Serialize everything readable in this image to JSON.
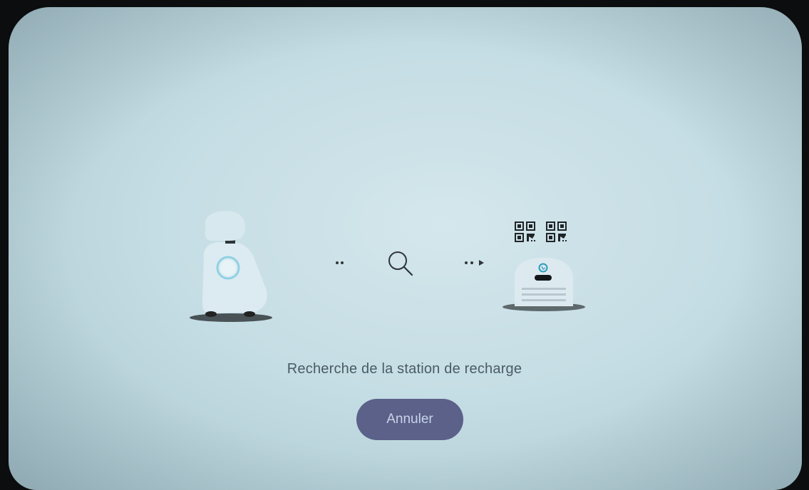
{
  "status": {
    "message": "Recherche de la station de recharge"
  },
  "actions": {
    "cancel_label": "Annuler"
  },
  "icons": {
    "robot": "robot-icon",
    "search": "search-icon",
    "station": "charging-station-icon",
    "qr": "qr-code-icon"
  },
  "colors": {
    "background": "#c9dfe5",
    "button": "#5b6189",
    "button_text": "#c9d3e8",
    "text": "#4a5b63",
    "accent": "#3aa6c4"
  }
}
